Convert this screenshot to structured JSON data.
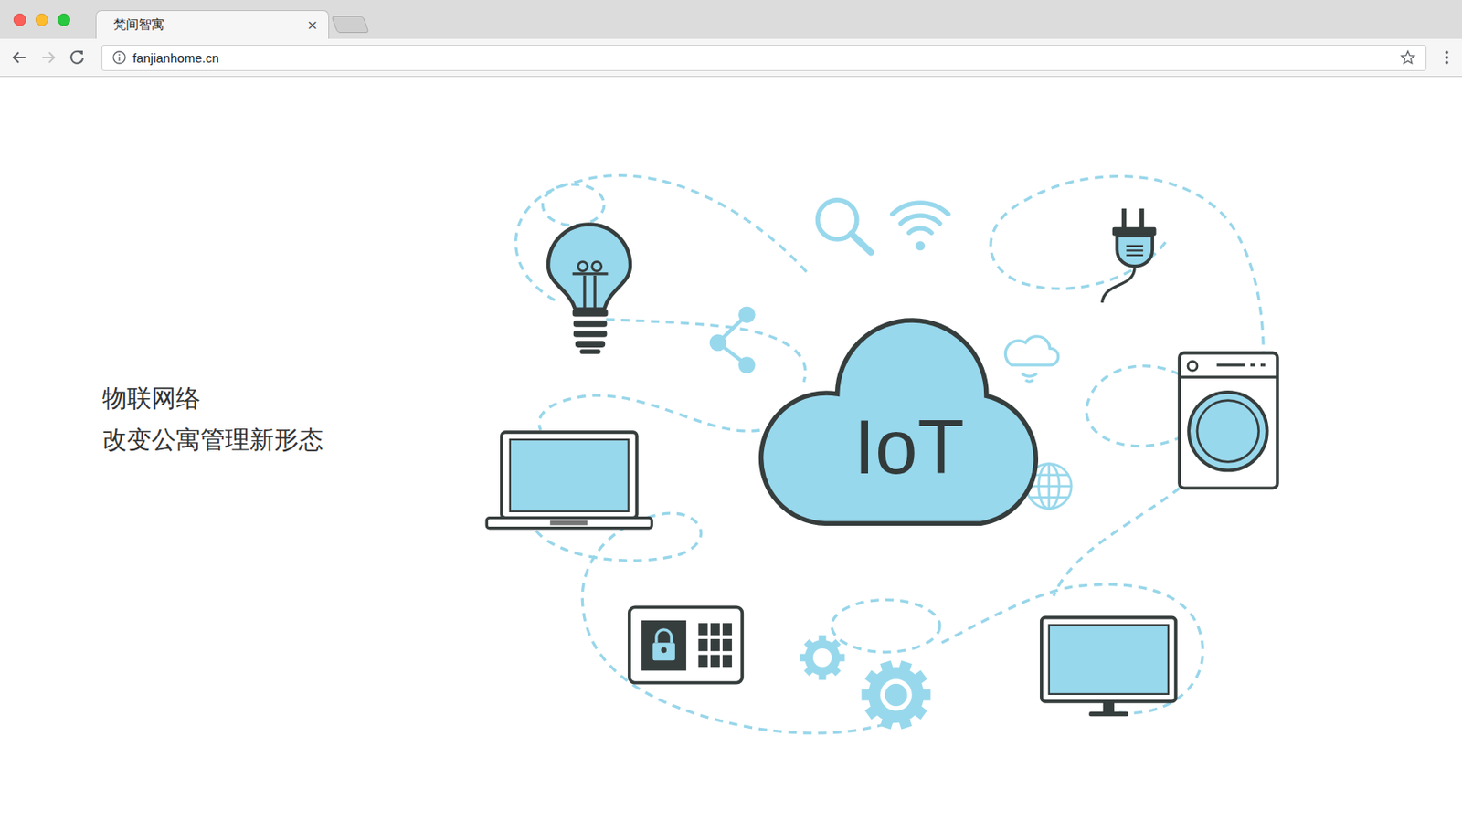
{
  "window": {
    "tab_title": "梵间智寓",
    "tab_close": "×",
    "url": "fanjianhome.cn"
  },
  "navigation": {
    "back": {
      "disabled": false
    },
    "forward": {
      "disabled": true
    },
    "bookmark": {
      "starred": false
    }
  },
  "hero": {
    "lines": [
      "物联网络",
      "改变公寓管理新形态"
    ]
  },
  "illustration": {
    "cloud_label": "IoT"
  }
}
